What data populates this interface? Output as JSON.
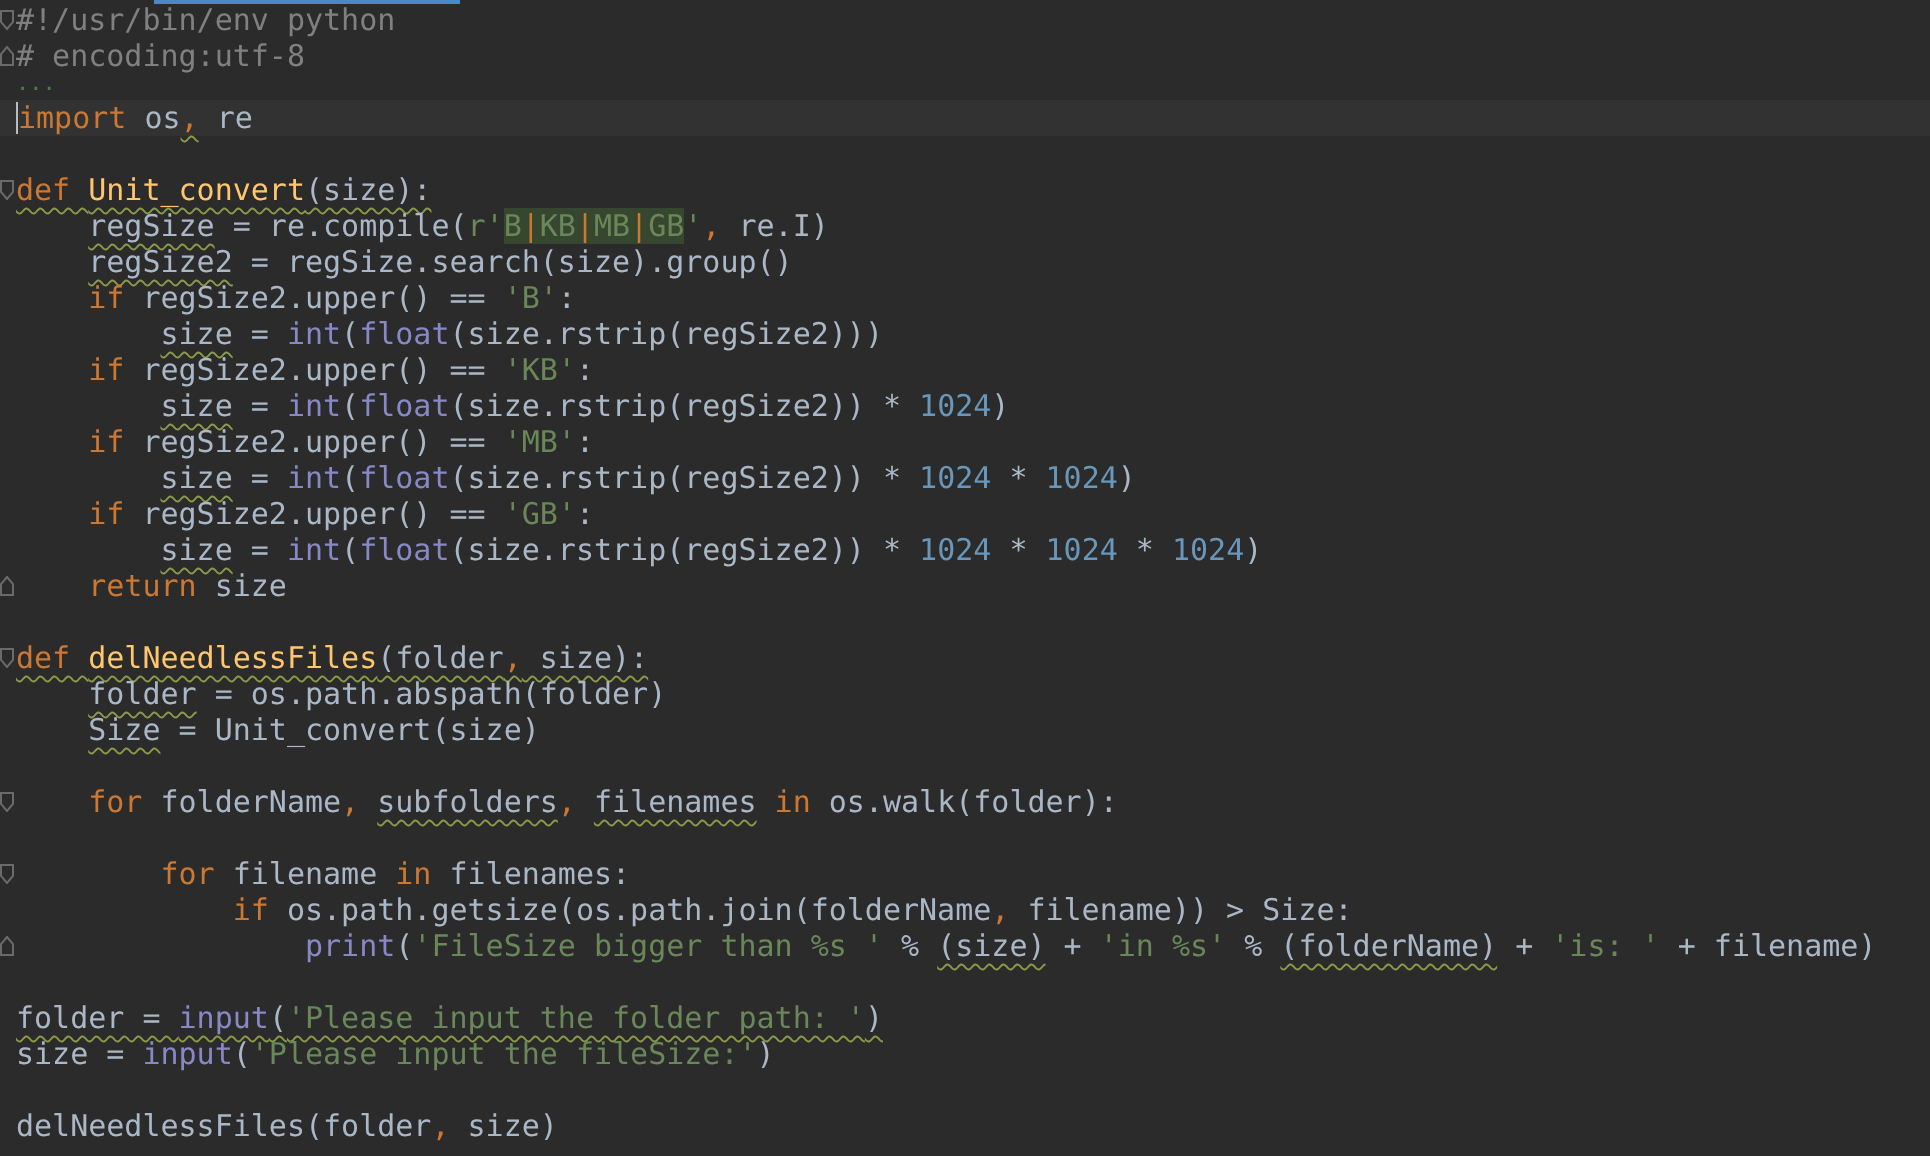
{
  "editor": {
    "lines": [
      {
        "kind": "code",
        "fold_open": true,
        "current": false,
        "tokens": [
          {
            "text": "#!/usr/bin/env python",
            "kind": "comment",
            "squiggle": false
          }
        ]
      },
      {
        "kind": "code",
        "fold_close": true,
        "current": false,
        "tokens": [
          {
            "text": "# encoding:utf-8",
            "kind": "comment",
            "squiggle": false
          }
        ]
      },
      {
        "kind": "fold_tail",
        "current": false,
        "tokens": [
          {
            "text": "...",
            "kind": "dim",
            "squiggle": false
          }
        ]
      },
      {
        "kind": "code",
        "current": true,
        "tokens": [
          {
            "text": "import",
            "kind": "keyword",
            "squiggle": false
          },
          {
            "text": " os",
            "kind": "plain",
            "squiggle": false
          },
          {
            "text": ",",
            "kind": "keyword",
            "squiggle": true
          },
          {
            "text": " re",
            "kind": "plain",
            "squiggle": false
          }
        ]
      },
      {
        "kind": "blank",
        "current": false
      },
      {
        "kind": "code",
        "fold_open": true,
        "current": false,
        "tokens": [
          {
            "text": "def ",
            "kind": "keyword",
            "squiggle": true
          },
          {
            "text": "Unit_convert",
            "kind": "function",
            "squiggle": true
          },
          {
            "text": "(size):",
            "kind": "plain",
            "squiggle": true
          }
        ],
        "children": [
          {
            "kind": "code",
            "current": false,
            "tokens": [
              {
                "text": "regSize",
                "kind": "plain",
                "squiggle": true
              },
              {
                "text": " = re.compile(",
                "kind": "plain",
                "squiggle": false
              },
              {
                "text": "r'",
                "kind": "string",
                "squiggle": false
              },
              {
                "text": "B|KB|MB|GB",
                "kind": "regex",
                "squiggle": false
              },
              {
                "text": "'",
                "kind": "string",
                "squiggle": false
              },
              {
                "text": ", ",
                "kind": "keyword",
                "squiggle": false
              },
              {
                "text": "re.I)",
                "kind": "plain",
                "squiggle": false
              }
            ]
          },
          {
            "kind": "code",
            "current": false,
            "tokens": [
              {
                "text": "regSize2",
                "kind": "plain",
                "squiggle": true
              },
              {
                "text": " = regSize.search(size).group()",
                "kind": "plain",
                "squiggle": false
              }
            ]
          },
          {
            "kind": "code",
            "current": false,
            "tokens": [
              {
                "text": "if",
                "kind": "keyword",
                "squiggle": false
              },
              {
                "text": " regSize2.upper() == ",
                "kind": "plain",
                "squiggle": false
              },
              {
                "text": "'B'",
                "kind": "string",
                "squiggle": false
              },
              {
                "text": ":",
                "kind": "plain",
                "squiggle": false
              }
            ],
            "children": [
              {
                "kind": "code",
                "current": false,
                "tokens": [
                  {
                    "text": "size",
                    "kind": "plain",
                    "squiggle": true
                  },
                  {
                    "text": " = ",
                    "kind": "plain",
                    "squiggle": false
                  },
                  {
                    "text": "int",
                    "kind": "builtin",
                    "squiggle": false
                  },
                  {
                    "text": "(",
                    "kind": "plain",
                    "squiggle": false
                  },
                  {
                    "text": "float",
                    "kind": "builtin",
                    "squiggle": false
                  },
                  {
                    "text": "(size.rstrip(regSize2)))",
                    "kind": "plain",
                    "squiggle": false
                  }
                ]
              }
            ]
          },
          {
            "kind": "code",
            "current": false,
            "tokens": [
              {
                "text": "if",
                "kind": "keyword",
                "squiggle": false
              },
              {
                "text": " regSize2.upper() == ",
                "kind": "plain",
                "squiggle": false
              },
              {
                "text": "'KB'",
                "kind": "string",
                "squiggle": false
              },
              {
                "text": ":",
                "kind": "plain",
                "squiggle": false
              }
            ],
            "children": [
              {
                "kind": "code",
                "current": false,
                "tokens": [
                  {
                    "text": "size",
                    "kind": "plain",
                    "squiggle": true
                  },
                  {
                    "text": " = ",
                    "kind": "plain",
                    "squiggle": false
                  },
                  {
                    "text": "int",
                    "kind": "builtin",
                    "squiggle": false
                  },
                  {
                    "text": "(",
                    "kind": "plain",
                    "squiggle": false
                  },
                  {
                    "text": "float",
                    "kind": "builtin",
                    "squiggle": false
                  },
                  {
                    "text": "(size.rstrip(regSize2)) * ",
                    "kind": "plain",
                    "squiggle": false
                  },
                  {
                    "text": "1024",
                    "kind": "number",
                    "squiggle": false
                  },
                  {
                    "text": ")",
                    "kind": "plain",
                    "squiggle": false
                  }
                ]
              }
            ]
          },
          {
            "kind": "code",
            "current": false,
            "tokens": [
              {
                "text": "if",
                "kind": "keyword",
                "squiggle": false
              },
              {
                "text": " regSize2.upper() == ",
                "kind": "plain",
                "squiggle": false
              },
              {
                "text": "'MB'",
                "kind": "string",
                "squiggle": false
              },
              {
                "text": ":",
                "kind": "plain",
                "squiggle": false
              }
            ],
            "children": [
              {
                "kind": "code",
                "current": false,
                "tokens": [
                  {
                    "text": "size",
                    "kind": "plain",
                    "squiggle": true
                  },
                  {
                    "text": " = ",
                    "kind": "plain",
                    "squiggle": false
                  },
                  {
                    "text": "int",
                    "kind": "builtin",
                    "squiggle": false
                  },
                  {
                    "text": "(",
                    "kind": "plain",
                    "squiggle": false
                  },
                  {
                    "text": "float",
                    "kind": "builtin",
                    "squiggle": false
                  },
                  {
                    "text": "(size.rstrip(regSize2)) * ",
                    "kind": "plain",
                    "squiggle": false
                  },
                  {
                    "text": "1024",
                    "kind": "number",
                    "squiggle": false
                  },
                  {
                    "text": " * ",
                    "kind": "plain",
                    "squiggle": false
                  },
                  {
                    "text": "1024",
                    "kind": "number",
                    "squiggle": false
                  },
                  {
                    "text": ")",
                    "kind": "plain",
                    "squiggle": false
                  }
                ]
              }
            ]
          },
          {
            "kind": "code",
            "current": false,
            "tokens": [
              {
                "text": "if",
                "kind": "keyword",
                "squiggle": false
              },
              {
                "text": " regSize2.upper() == ",
                "kind": "plain",
                "squiggle": false
              },
              {
                "text": "'GB'",
                "kind": "string",
                "squiggle": false
              },
              {
                "text": ":",
                "kind": "plain",
                "squiggle": false
              }
            ],
            "children": [
              {
                "kind": "code",
                "current": false,
                "tokens": [
                  {
                    "text": "size",
                    "kind": "plain",
                    "squiggle": true
                  },
                  {
                    "text": " = ",
                    "kind": "plain",
                    "squiggle": false
                  },
                  {
                    "text": "int",
                    "kind": "builtin",
                    "squiggle": false
                  },
                  {
                    "text": "(",
                    "kind": "plain",
                    "squiggle": false
                  },
                  {
                    "text": "float",
                    "kind": "builtin",
                    "squiggle": false
                  },
                  {
                    "text": "(size.rstrip(regSize2)) * ",
                    "kind": "plain",
                    "squiggle": false
                  },
                  {
                    "text": "1024",
                    "kind": "number",
                    "squiggle": false
                  },
                  {
                    "text": " * ",
                    "kind": "plain",
                    "squiggle": false
                  },
                  {
                    "text": "1024",
                    "kind": "number",
                    "squiggle": false
                  },
                  {
                    "text": " * ",
                    "kind": "plain",
                    "squiggle": false
                  },
                  {
                    "text": "1024",
                    "kind": "number",
                    "squiggle": false
                  },
                  {
                    "text": ")",
                    "kind": "plain",
                    "squiggle": false
                  }
                ]
              }
            ]
          },
          {
            "kind": "code",
            "fold_close": true,
            "current": false,
            "tokens": [
              {
                "text": "return",
                "kind": "keyword",
                "squiggle": false
              },
              {
                "text": " size",
                "kind": "plain",
                "squiggle": false
              }
            ]
          }
        ]
      },
      {
        "kind": "blank",
        "current": false
      },
      {
        "kind": "code",
        "fold_open": true,
        "current": false,
        "tokens": [
          {
            "text": "def ",
            "kind": "keyword",
            "squiggle": true
          },
          {
            "text": "delNeedlessFiles",
            "kind": "function",
            "squiggle": true
          },
          {
            "text": "(folder",
            "kind": "plain",
            "squiggle": true
          },
          {
            "text": ",",
            "kind": "keyword",
            "squiggle": true
          },
          {
            "text": " size):",
            "kind": "plain",
            "squiggle": true
          }
        ],
        "children": [
          {
            "kind": "code",
            "current": false,
            "tokens": [
              {
                "text": "folder",
                "kind": "plain",
                "squiggle": true
              },
              {
                "text": " = os.path.abspath(folder)",
                "kind": "plain",
                "squiggle": false
              }
            ]
          },
          {
            "kind": "code",
            "current": false,
            "tokens": [
              {
                "text": "Size",
                "kind": "plain",
                "squiggle": true
              },
              {
                "text": " = Unit_convert(size)",
                "kind": "plain",
                "squiggle": false
              }
            ]
          },
          {
            "kind": "blank",
            "current": false
          },
          {
            "kind": "code",
            "fold_open": true,
            "current": false,
            "tokens": [
              {
                "text": "for",
                "kind": "keyword",
                "squiggle": false
              },
              {
                "text": " folderName",
                "kind": "plain",
                "squiggle": false
              },
              {
                "text": ", ",
                "kind": "keyword",
                "squiggle": false
              },
              {
                "text": "subfolders",
                "kind": "plain",
                "squiggle": true
              },
              {
                "text": ", ",
                "kind": "keyword",
                "squiggle": false
              },
              {
                "text": "filenames",
                "kind": "plain",
                "squiggle": true
              },
              {
                "text": " in",
                "kind": "keyword",
                "squiggle": false
              },
              {
                "text": " os.walk(folder):",
                "kind": "plain",
                "squiggle": false
              }
            ],
            "children": [
              {
                "kind": "blank",
                "current": false
              },
              {
                "kind": "code",
                "fold_open": true,
                "current": false,
                "tokens": [
                  {
                    "text": "for",
                    "kind": "keyword",
                    "squiggle": false
                  },
                  {
                    "text": " filename ",
                    "kind": "plain",
                    "squiggle": false
                  },
                  {
                    "text": "in",
                    "kind": "keyword",
                    "squiggle": false
                  },
                  {
                    "text": " filenames:",
                    "kind": "plain",
                    "squiggle": false
                  }
                ],
                "children": [
                  {
                    "kind": "code",
                    "current": false,
                    "tokens": [
                      {
                        "text": "if",
                        "kind": "keyword",
                        "squiggle": false
                      },
                      {
                        "text": " os.path.getsize(os.path.join(folderName",
                        "kind": "plain",
                        "squiggle": false
                      },
                      {
                        "text": ",",
                        "kind": "keyword",
                        "squiggle": false
                      },
                      {
                        "text": " filename)) > Size:",
                        "kind": "plain",
                        "squiggle": false
                      }
                    ],
                    "children": [
                      {
                        "kind": "code",
                        "fold_close": true,
                        "current": false,
                        "tokens": [
                          {
                            "text": "print",
                            "kind": "builtin",
                            "squiggle": false
                          },
                          {
                            "text": "(",
                            "kind": "plain",
                            "squiggle": false
                          },
                          {
                            "text": "'FileSize bigger than %s '",
                            "kind": "string",
                            "squiggle": false
                          },
                          {
                            "text": " % ",
                            "kind": "plain",
                            "squiggle": false
                          },
                          {
                            "text": "(size)",
                            "kind": "plain",
                            "squiggle": true
                          },
                          {
                            "text": " + ",
                            "kind": "plain",
                            "squiggle": false
                          },
                          {
                            "text": "'in %s'",
                            "kind": "string",
                            "squiggle": false
                          },
                          {
                            "text": " % ",
                            "kind": "plain",
                            "squiggle": false
                          },
                          {
                            "text": "(folderName)",
                            "kind": "plain",
                            "squiggle": true
                          },
                          {
                            "text": " + ",
                            "kind": "plain",
                            "squiggle": false
                          },
                          {
                            "text": "'is: '",
                            "kind": "string",
                            "squiggle": false
                          },
                          {
                            "text": " + filename)",
                            "kind": "plain",
                            "squiggle": false
                          }
                        ]
                      }
                    ]
                  }
                ]
              }
            ]
          }
        ]
      },
      {
        "kind": "blank",
        "current": false
      },
      {
        "kind": "code",
        "current": false,
        "tokens": [
          {
            "text": "folder = ",
            "kind": "plain",
            "squiggle": true
          },
          {
            "text": "input",
            "kind": "builtin",
            "squiggle": true
          },
          {
            "text": "(",
            "kind": "plain",
            "squiggle": true
          },
          {
            "text": "'Please input the folder path: '",
            "kind": "string",
            "squiggle": true
          },
          {
            "text": ")",
            "kind": "plain",
            "squiggle": true
          }
        ]
      },
      {
        "kind": "code",
        "current": false,
        "tokens": [
          {
            "text": "size = ",
            "kind": "plain",
            "squiggle": false
          },
          {
            "text": "input",
            "kind": "builtin",
            "squiggle": false
          },
          {
            "text": "(",
            "kind": "plain",
            "squiggle": false
          },
          {
            "text": "'Please input the fileSize:'",
            "kind": "string",
            "squiggle": false
          },
          {
            "text": ")",
            "kind": "plain",
            "squiggle": false
          }
        ]
      },
      {
        "kind": "blank",
        "current": false
      },
      {
        "kind": "code",
        "current": false,
        "tokens": [
          {
            "text": "delNeedlessFiles(folder",
            "kind": "plain",
            "squiggle": false
          },
          {
            "text": ",",
            "kind": "keyword",
            "squiggle": false
          },
          {
            "text": " size)",
            "kind": "plain",
            "squiggle": false
          }
        ]
      }
    ]
  }
}
